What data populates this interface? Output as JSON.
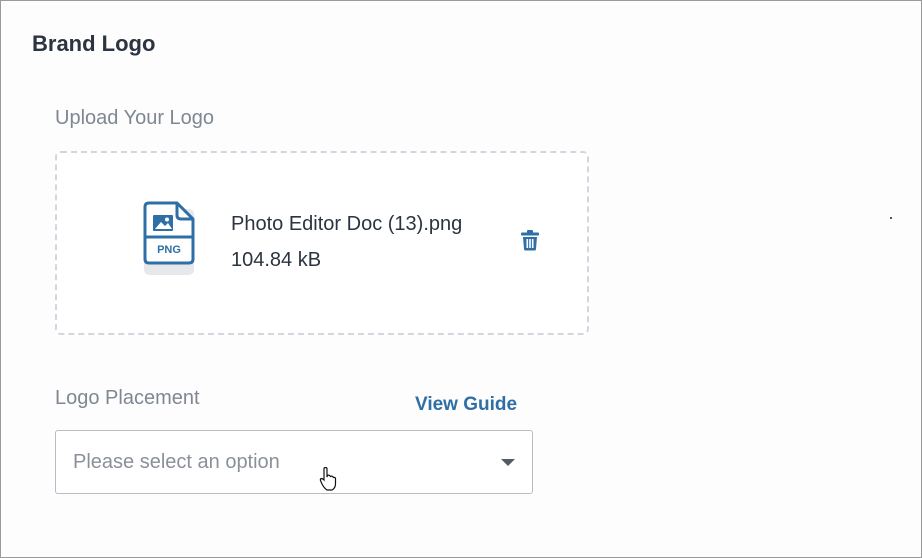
{
  "section": {
    "title": "Brand Logo"
  },
  "upload": {
    "label": "Upload Your Logo",
    "file": {
      "icon": "png-file-icon",
      "icon_badge": "PNG",
      "name": "Photo Editor Doc (13).png",
      "size": "104.84 kB"
    },
    "delete_icon": "trash-icon"
  },
  "placement": {
    "label": "Logo Placement",
    "guide_link": "View Guide",
    "select_placeholder": "Please select an option",
    "caret_icon": "chevron-down-icon"
  },
  "colors": {
    "accent": "#2f6fa6",
    "text": "#2b3440",
    "muted": "#7f8793",
    "border_dashed": "#d3d6de"
  }
}
